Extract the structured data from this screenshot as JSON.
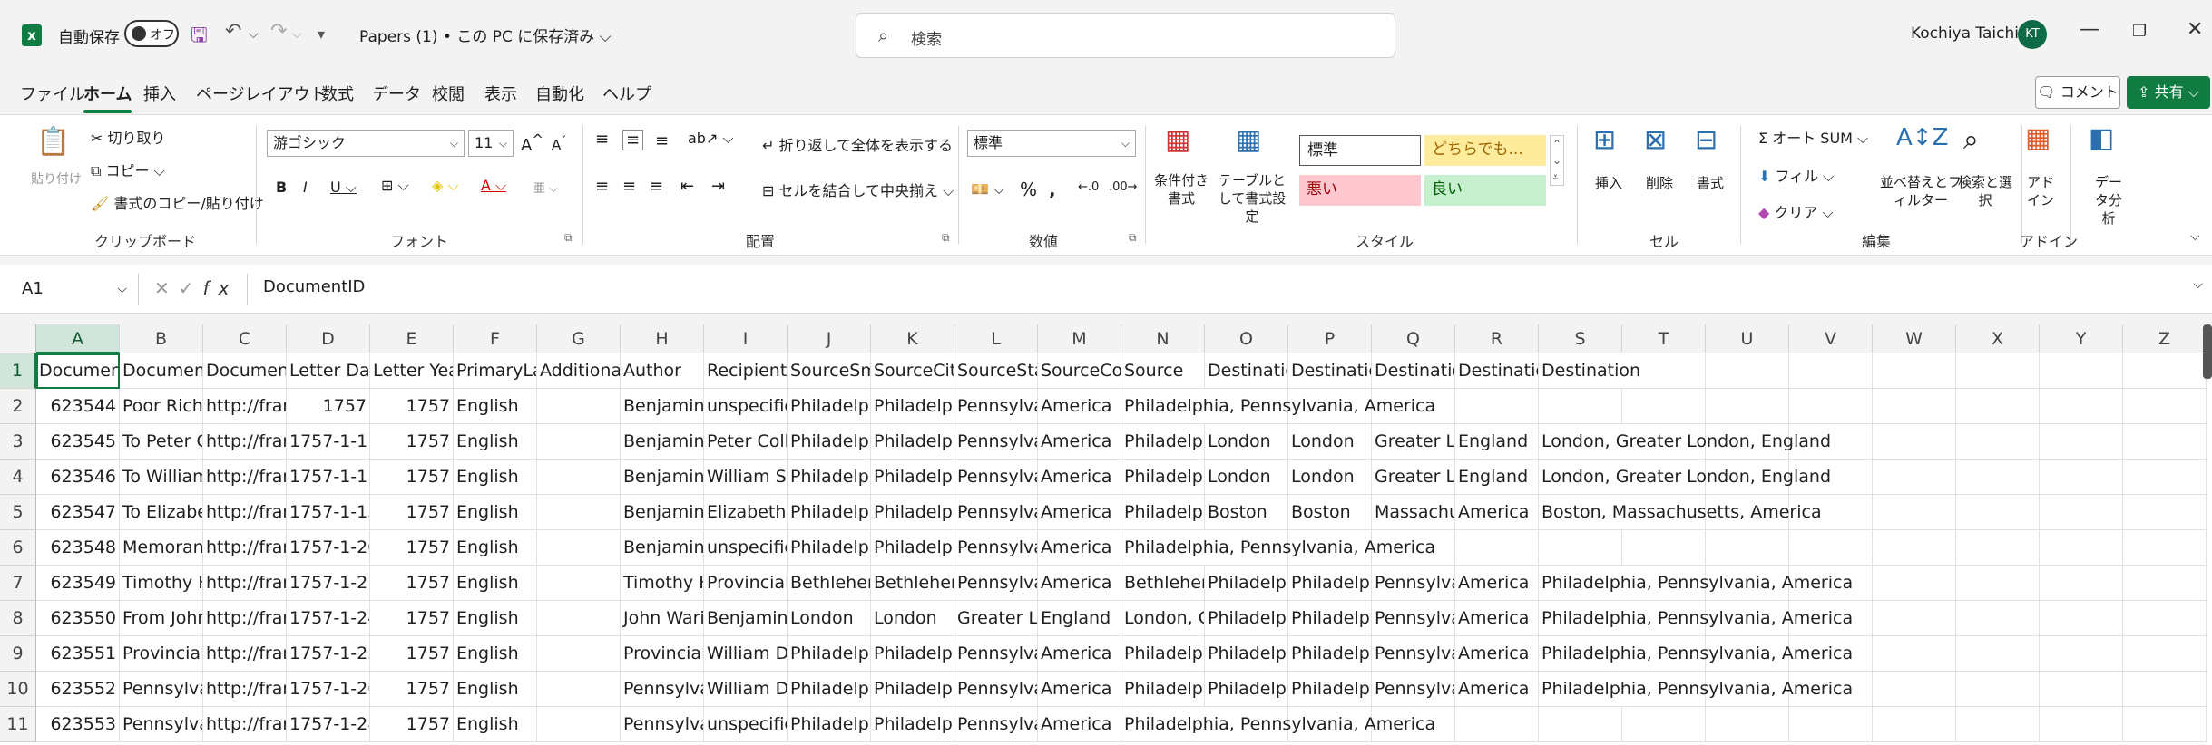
{
  "titlebar": {
    "logo": "x",
    "autosave_label": "自動保存",
    "autosave_state": "オフ",
    "doc_title": "Papers (1) • この PC に保存済み ⌵",
    "search_placeholder": "検索",
    "user_name": "Kochiya Taichi",
    "user_initials": "KT"
  },
  "menu": {
    "tabs": [
      "ファイル",
      "ホーム",
      "挿入",
      "ページレイアウト",
      "数式",
      "データ",
      "校閲",
      "表示",
      "自動化",
      "ヘルプ"
    ],
    "active_tab": "ホーム",
    "comment_label": "コメント",
    "share_label": "共有"
  },
  "ribbon": {
    "clipboard": {
      "paste": "貼り付け",
      "cut": "切り取り",
      "copy": "コピー",
      "format_painter": "書式のコピー/貼り付け",
      "group_label": "クリップボード"
    },
    "font": {
      "font_name": "游ゴシック",
      "font_size": "11",
      "group_label": "フォント"
    },
    "alignment": {
      "wrap_text": "折り返して全体を表示する",
      "merge_center": "セルを結合して中央揃え",
      "group_label": "配置"
    },
    "number": {
      "format": "標準",
      "group_label": "数値"
    },
    "styles": {
      "conditional_format": "条件付き書式",
      "format_as_table": "テーブルとして書式設定",
      "cell_styles": [
        "標準",
        "どちらでも...",
        "悪い",
        "良い"
      ],
      "group_label": "スタイル"
    },
    "cells": {
      "insert": "挿入",
      "delete": "削除",
      "format": "書式",
      "group_label": "セル"
    },
    "editing": {
      "autosum": "オート SUM",
      "fill": "フィル",
      "clear": "クリア",
      "sort_filter": "並べ替えとフィルター",
      "find_select": "検索と選択",
      "group_label": "編集"
    },
    "addins": {
      "addin": "アドイン",
      "group_label": "アドイン"
    },
    "analysis": {
      "data_analysis": "データ分析"
    }
  },
  "formula_bar": {
    "name_box": "A1",
    "content": "DocumentID"
  },
  "sheet": {
    "columns": [
      "A",
      "B",
      "C",
      "D",
      "E",
      "F",
      "G",
      "H",
      "I",
      "J",
      "K",
      "L",
      "M",
      "N",
      "O",
      "P",
      "Q",
      "R",
      "S",
      "T",
      "U",
      "V",
      "W",
      "X",
      "Y",
      "Z"
    ],
    "row_numbers": [
      "1",
      "2",
      "3",
      "4",
      "5",
      "6",
      "7",
      "8",
      "9",
      "10",
      "11"
    ],
    "rows": [
      [
        "Documen",
        "Document",
        "Document",
        "Letter Dat",
        "Letter Yea",
        "PrimaryLa",
        "Additional",
        "Author",
        "Recipient",
        "SourceSm",
        "SourceCity",
        "SourceSta",
        "SourceCou",
        "Source",
        "Destinatio",
        "Destinatio",
        "Destinatio",
        "Destinatio",
        "Destination"
      ],
      [
        "623544",
        "Poor Richa",
        "http://frar",
        "1757",
        "1757",
        "English",
        "",
        "Benjamin",
        "unspecifie",
        "Philadelpl",
        "Philadelpl",
        "Pennsylva",
        "America",
        "Philadelphia, Pennsylvania, America",
        "",
        "",
        "",
        "",
        ""
      ],
      [
        "623545",
        "To Peter C",
        "http://frar",
        "1757-1-1",
        "1757",
        "English",
        "",
        "Benjamin",
        "Peter Colli",
        "Philadelpl",
        "Philadelpl",
        "Pennsylva",
        "America",
        "Philadelpl",
        "London",
        "London",
        "Greater Lc",
        "England",
        "London, Greater London, England"
      ],
      [
        "623546",
        "To William",
        "http://frar",
        "1757-1-1",
        "1757",
        "English",
        "",
        "Benjamin",
        "William St",
        "Philadelpl",
        "Philadelpl",
        "Pennsylva",
        "America",
        "Philadelpl",
        "London",
        "London",
        "Greater Lc",
        "England",
        "London, Greater London, England"
      ],
      [
        "623547",
        "To Elizabe",
        "http://frar",
        "1757-1-13",
        "1757",
        "English",
        "",
        "Benjamin",
        "Elizabeth",
        "Philadelpl",
        "Philadelpl",
        "Pennsylva",
        "America",
        "Philadelpl",
        "Boston",
        "Boston",
        "Massachu",
        "America",
        "Boston, Massachusetts, America"
      ],
      [
        "623548",
        "Memoranc",
        "http://frar",
        "1757-1-20",
        "1757",
        "English",
        "",
        "Benjamin",
        "unspecifie",
        "Philadelpl",
        "Philadelpl",
        "Pennsylva",
        "America",
        "Philadelphia, Pennsylvania, America",
        "",
        "",
        "",
        "",
        ""
      ],
      [
        "623549",
        "Timothy H",
        "http://frar",
        "1757-1-21",
        "1757",
        "English",
        "",
        "Timothy H",
        "Provincial",
        "Bethlehen",
        "Bethlehen",
        "Pennsylva",
        "America",
        "Bethlehen",
        "Philadelpl",
        "Philadelpl",
        "Pennsylva",
        "America",
        "Philadelphia, Pennsylvania, America"
      ],
      [
        "623550",
        "From John",
        "http://frar",
        "1757-1-24",
        "1757",
        "English",
        "",
        "John Wari",
        "Benjamin",
        "London",
        "London",
        "Greater Lc",
        "England",
        "London, G",
        "Philadelpl",
        "Philadelpl",
        "Pennsylva",
        "America",
        "Philadelphia, Pennsylvania, America"
      ],
      [
        "623551",
        "Provincial",
        "http://frar",
        "1757-1-25",
        "1757",
        "English",
        "",
        "Provincial",
        "William D",
        "Philadelpl",
        "Philadelpl",
        "Pennsylva",
        "America",
        "Philadelpl",
        "Philadelpl",
        "Philadelpl",
        "Pennsylva",
        "America",
        "Philadelphia, Pennsylvania, America"
      ],
      [
        "623552",
        "Pennsylva",
        "http://frar",
        "1757-1-26",
        "1757",
        "English",
        "",
        "Pennsylva",
        "William D",
        "Philadelpl",
        "Philadelpl",
        "Pennsylva",
        "America",
        "Philadelpl",
        "Philadelpl",
        "Philadelpl",
        "Pennsylva",
        "America",
        "Philadelphia, Pennsylvania, America"
      ],
      [
        "623553",
        "Pennsylva",
        "http://frar",
        "1757-1-28",
        "1757",
        "English",
        "",
        "Pennsylva",
        "unspecifie",
        "Philadelpl",
        "Philadelpl",
        "Pennsylva",
        "America",
        "Philadelphia, Pennsylvania, America",
        "",
        "",
        "",
        "",
        ""
      ]
    ]
  },
  "colors": {
    "accent": "#107c41",
    "bad_bg": "#ffc7ce",
    "good_bg": "#c6efce",
    "neutral_bg": "#ffeb9c"
  }
}
